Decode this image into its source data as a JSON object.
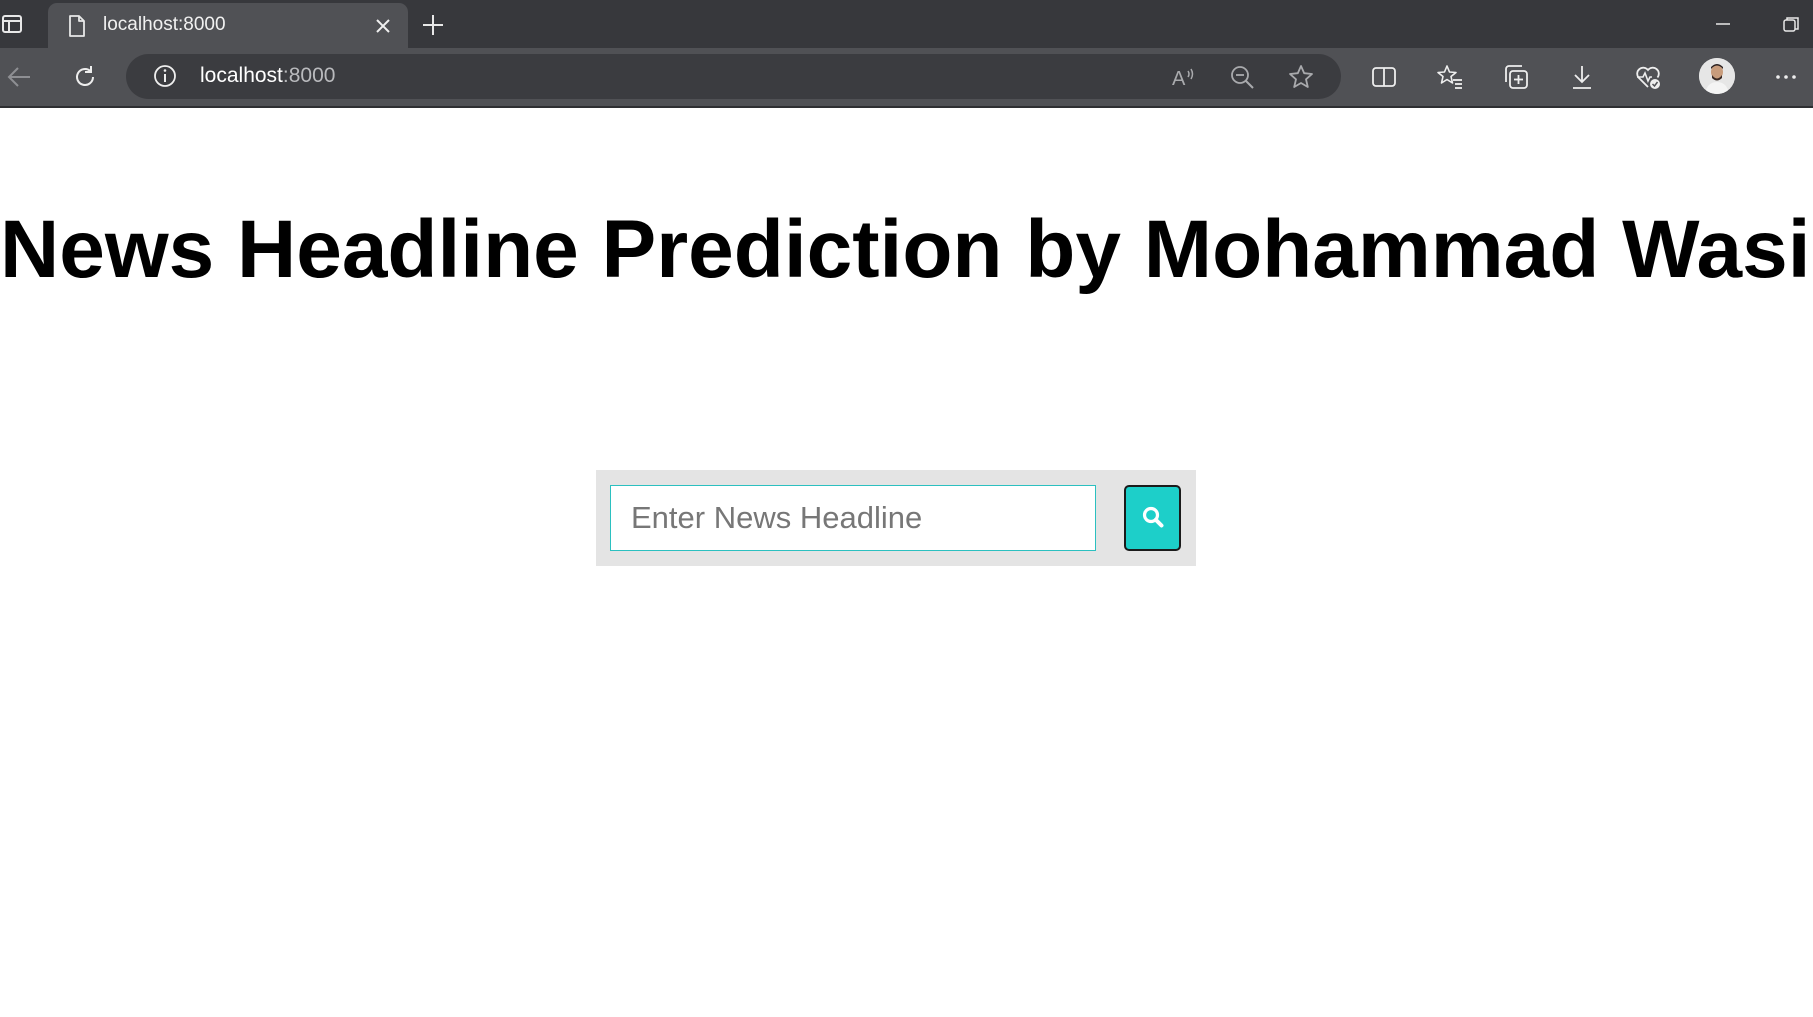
{
  "browser": {
    "tab": {
      "title": "localhost:8000"
    },
    "address": {
      "host": "localhost",
      "port": ":8000"
    },
    "icons": {
      "tab_actions": "tab-actions-icon",
      "favicon": "page-icon",
      "close": "close-icon",
      "new_tab": "plus-icon",
      "back": "back-arrow-icon",
      "refresh": "refresh-icon",
      "site_info": "info-icon",
      "read_aloud": "read-aloud-icon",
      "zoom_out": "zoom-out-icon",
      "favorite": "star-icon",
      "split_screen": "split-screen-icon",
      "favorites": "favorites-list-icon",
      "collections": "collections-icon",
      "downloads": "download-icon",
      "browser_essentials": "heart-pulse-icon",
      "profile": "avatar",
      "menu": "more-icon"
    }
  },
  "page": {
    "title": "News Headline Prediction by Mohammad Wasiq",
    "search": {
      "placeholder": "Enter News Headline",
      "value": "",
      "button_icon": "search-icon"
    }
  },
  "colors": {
    "tabbar": "#37383c",
    "toolbar": "#505155",
    "search_panel": "#e4e4e4",
    "input_border": "#2bc0c0",
    "button_accent": "#1dcfc9"
  }
}
